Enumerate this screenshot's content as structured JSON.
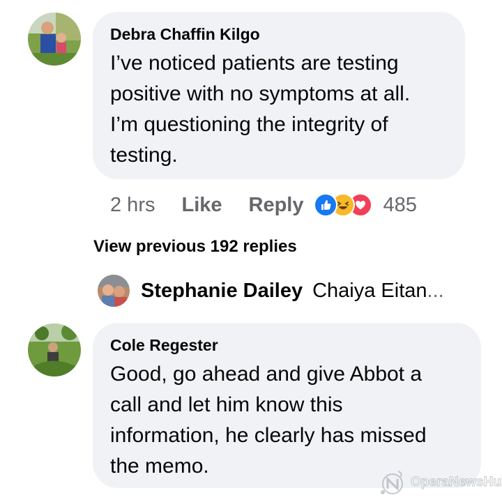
{
  "comment1": {
    "author": "Debra Chaffin Kilgo",
    "lines": [
      "I’ve noticed patients are testing",
      "positive with no symptoms at all.",
      "I’m questioning the integrity of",
      "testing."
    ],
    "time": "2 hrs",
    "like_label": "Like",
    "reply_label": "Reply",
    "reaction_count": "485",
    "reactions": [
      "like-icon",
      "haha-icon",
      "love-icon"
    ]
  },
  "view_previous": "View previous 192 replies",
  "reply_preview": {
    "author": "Stephanie Dailey",
    "text": "Chaiya Eitan",
    "ellipsis": "..."
  },
  "comment2": {
    "author": "Cole Regester",
    "lines": [
      "Good, go ahead and give Abbot a",
      "call and let him know this",
      "information, he clearly has missed",
      "the memo."
    ]
  },
  "watermark": "OperaNewsHub",
  "colors": {
    "bubble": "#f0f2f5",
    "meta_text": "#65676b",
    "like_blue": "#1877f2",
    "haha_yellow": "#f7b928",
    "love_red": "#f33e58"
  }
}
